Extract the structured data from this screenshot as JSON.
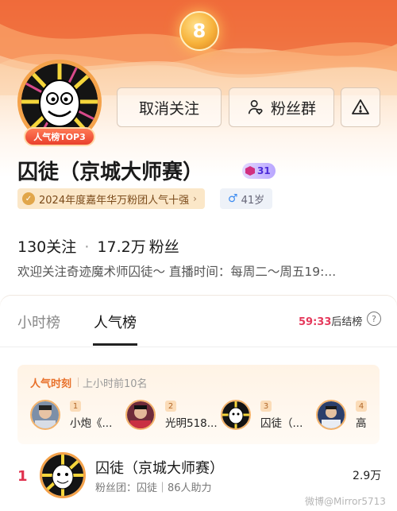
{
  "header": {
    "rank_coin_icon": "rank-8-medal-icon",
    "avatar_badge": "人气榜TOP3",
    "buttons": {
      "unfollow": "取消关注",
      "fans_group": "粉丝群",
      "report_icon": "warning-icon"
    }
  },
  "profile": {
    "name": "囚徒（京城大师赛）",
    "level": "31",
    "award_tag": "2024年度嘉年华万粉团人气十强",
    "gender_age": "41岁",
    "following": "130",
    "following_label": "关注",
    "fans": "17.2万",
    "fans_label": "粉丝",
    "bio": "欢迎关注奇迹魔术师囚徒～ 直播时间：每周二～周五19:..."
  },
  "rank_panel": {
    "tabs": [
      "小时榜",
      "人气榜"
    ],
    "active_tab": "人气榜",
    "countdown_time": "59:33",
    "countdown_suffix": "后结榜",
    "moment": {
      "title": "人气时刻",
      "subtitle": "上小时前10名",
      "entries": [
        {
          "rank": "1",
          "name": "小炮《..."
        },
        {
          "rank": "2",
          "name": "光明518..."
        },
        {
          "rank": "3",
          "name": "囚徒（..."
        },
        {
          "rank": "4",
          "name": "高"
        }
      ]
    },
    "rows": [
      {
        "rank": "1",
        "name": "囚徒（京城大师赛）",
        "sub": "粉丝团：囚徒｜86人助力",
        "score": "2.9万"
      }
    ]
  },
  "watermark": "微博@Mirror5713",
  "colors": {
    "accent_red": "#e53a5c",
    "banner_orange": "#f2703f",
    "gold": "#f4a24a"
  }
}
